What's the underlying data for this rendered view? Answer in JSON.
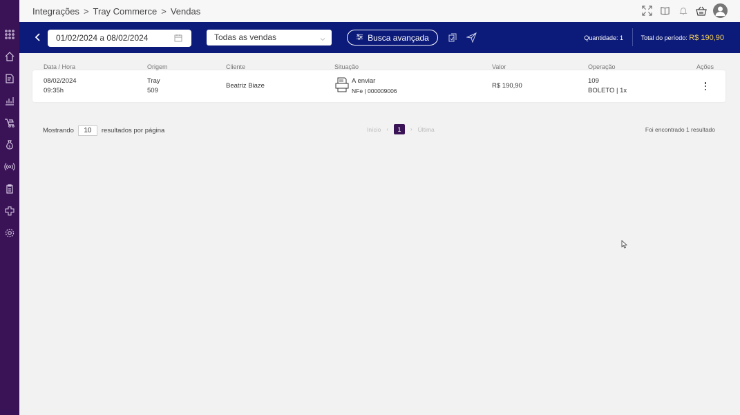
{
  "breadcrumb": {
    "item1": "Integrações",
    "sep": ">",
    "item2": "Tray Commerce",
    "item3": "Vendas"
  },
  "icons": {
    "sidebar": [
      "apps-grid-icon",
      "home-icon",
      "edit-document-icon",
      "chart-icon",
      "delivery-icon",
      "money-bag-icon",
      "broadcast-icon",
      "clipboard-icon",
      "puzzle-icon",
      "settings-icon"
    ],
    "top": [
      "fullscreen-icon",
      "help-book-icon",
      "bell-icon",
      "basket-icon",
      "user-avatar-icon"
    ]
  },
  "filter": {
    "date_range": "01/02/2024 a 08/02/2024",
    "sales_select": "Todas as vendas",
    "advanced_search": "Busca avançada",
    "quantity_label": "Quantidade:",
    "quantity_value": "1",
    "total_label": "Total do período:",
    "total_value": "R$ 190,90"
  },
  "table": {
    "headers": [
      "Data / Hora",
      "Origem",
      "Cliente",
      "Situação",
      "Valor",
      "Operação",
      "Ações"
    ],
    "rows": [
      {
        "date": "08/02/2024",
        "time": "09:35h",
        "origin": "Tray",
        "origin_id": "509",
        "client": "Beatriz Biaze",
        "status": "A enviar",
        "nfe": "NFe | 000009006",
        "value": "R$ 190,90",
        "operation_id": "109",
        "operation": "BOLETO | 1x"
      }
    ]
  },
  "pagination": {
    "showing_label": "Mostrando",
    "per_page": "10",
    "per_page_suffix": "resultados por página",
    "first": "Início",
    "current": "1",
    "last": "Última",
    "result_text": "Foi encontrado 1 resultado"
  },
  "colors": {
    "sidebar": "#3a1356",
    "filterbar": "#0c1a7a",
    "total_value": "#f3d05a"
  }
}
